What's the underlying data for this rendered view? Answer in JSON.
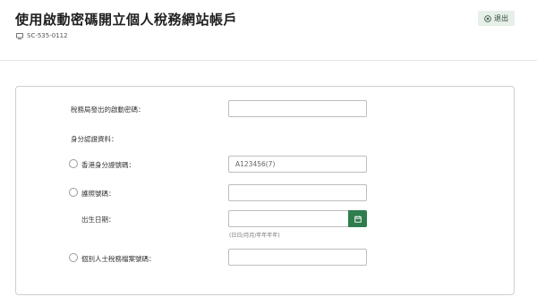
{
  "header": {
    "title": "使用啟動密碼開立個人稅務網站帳戶",
    "code": "SC-535-0112",
    "logout_label": "退出"
  },
  "form": {
    "activation_code_label": "稅務局發出的啟動密碼：",
    "identity_section_label": "身分認證資料：",
    "hkid_label": "香港身分證號碼：",
    "hkid_placeholder": "A123456(7)",
    "passport_label": "護照號碼：",
    "dob_label": "出生日期：",
    "dob_hint": "(日日/月月/年年年年)",
    "file_no_label": "個別人士稅務檔案號碼："
  },
  "colors": {
    "accent": "#2f7d4f",
    "logout_bg": "#e7efe9"
  },
  "icons": {
    "code_icon": "monitor-icon",
    "logout_icon": "close-circle-icon",
    "calendar_icon": "calendar-icon"
  }
}
